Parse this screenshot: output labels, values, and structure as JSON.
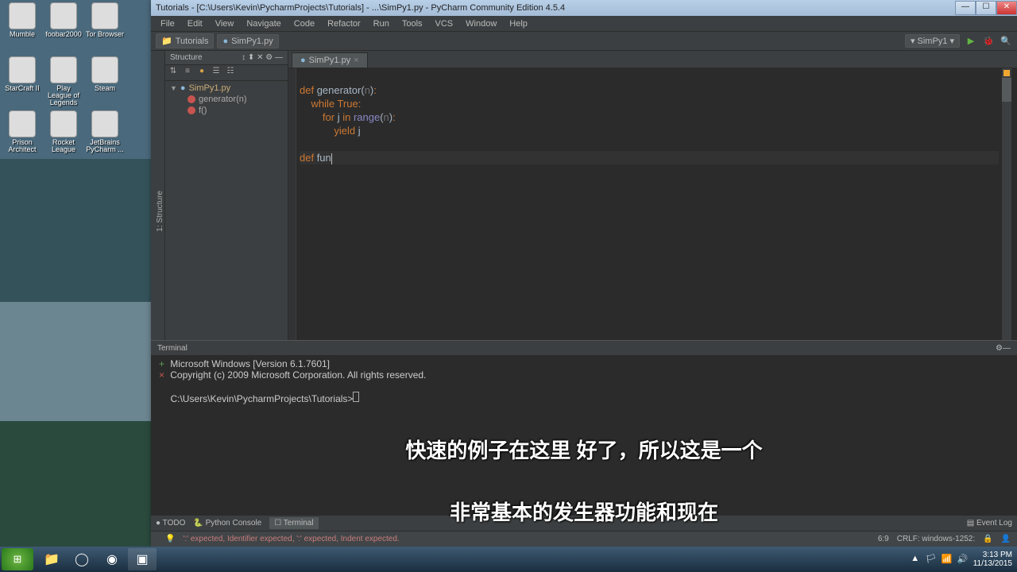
{
  "desktop_icons": [
    {
      "label": "Mumble"
    },
    {
      "label": "foobar2000"
    },
    {
      "label": "Tor Browser"
    },
    {
      "label": "StarCraft II"
    },
    {
      "label": "Play League of Legends"
    },
    {
      "label": "Steam"
    },
    {
      "label": "Prison Architect"
    },
    {
      "label": "Rocket League"
    },
    {
      "label": "JetBrains PyCharm ..."
    }
  ],
  "title": "Tutorials - [C:\\Users\\Kevin\\PycharmProjects\\Tutorials] - ...\\SimPy1.py - PyCharm Community Edition 4.5.4",
  "menu": [
    "File",
    "Edit",
    "View",
    "Navigate",
    "Code",
    "Refactor",
    "Run",
    "Tools",
    "VCS",
    "Window",
    "Help"
  ],
  "breadcrumbs": [
    {
      "icon": "📁",
      "label": "Tutorials"
    },
    {
      "icon": "",
      "label": "SimPy1.py"
    }
  ],
  "run_config": "SimPy1",
  "structure": {
    "title": "Structure",
    "file": "SimPy1.py",
    "members": [
      {
        "icon": "f",
        "label": "generator(n)"
      },
      {
        "icon": "f",
        "label": "f()"
      }
    ]
  },
  "editor_tab": "SimPy1.py",
  "code": {
    "l1_def": "def ",
    "l1_name": "generator",
    "l1_open": "(",
    "l1_param": "n",
    "l1_close": ")",
    "l2_while": "while ",
    "l2_true": "True",
    "l3_for": "for ",
    "l3_j": "j ",
    "l3_in": "in ",
    "l3_range": "range",
    "l3_open": "(",
    "l3_n": "n",
    "l3_close": ")",
    "l4_yield": "yield ",
    "l4_j": "j",
    "l6_def": "def ",
    "l6_name": "fun"
  },
  "terminal": {
    "title": "Terminal",
    "line1": "Microsoft Windows [Version 6.1.7601]",
    "line2": "Copyright (c) 2009 Microsoft Corporation.  All rights reserved.",
    "prompt": "C:\\Users\\Kevin\\PycharmProjects\\Tutorials>"
  },
  "subtitles": {
    "top": "快速的例子在这里 好了，所以这是一个",
    "bottom": "非常基本的发生器功能和现在"
  },
  "bottom_tools": {
    "todo": "TODO",
    "console": "Python Console",
    "terminal": "Terminal",
    "eventlog": "Event Log"
  },
  "status": {
    "hint": "':' expected, Identifier expected, ':' expected, Indent expected.",
    "pos": "6:9",
    "encoding": "CRLF:  windows-1252:"
  },
  "tray": {
    "time": "3:13 PM",
    "date": "11/13/2015"
  }
}
